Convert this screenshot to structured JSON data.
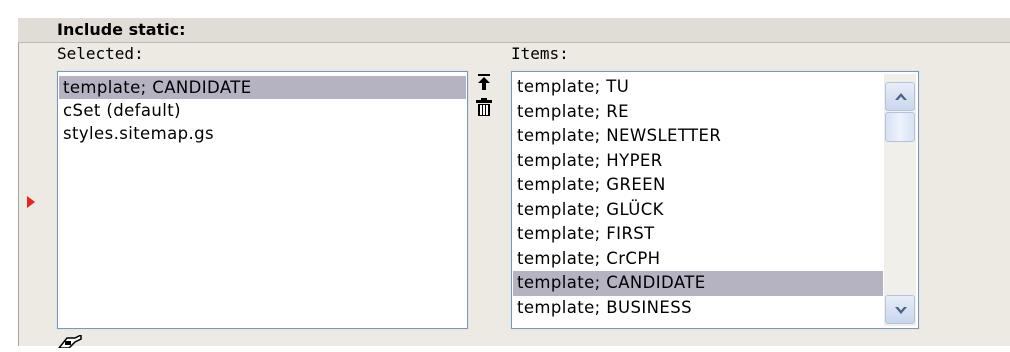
{
  "field": {
    "title": "Include static:"
  },
  "selected": {
    "label": "Selected:",
    "options": [
      {
        "text": "template; CANDIDATE",
        "highlighted": true
      },
      {
        "text": "cSet (default)",
        "highlighted": false
      },
      {
        "text": "styles.sitemap.gs",
        "highlighted": false
      }
    ]
  },
  "items": {
    "label": "Items:",
    "options": [
      {
        "text": "template; TU",
        "highlighted": false
      },
      {
        "text": "template; RE",
        "highlighted": false
      },
      {
        "text": "template; NEWSLETTER",
        "highlighted": false
      },
      {
        "text": "template; HYPER",
        "highlighted": false
      },
      {
        "text": "template; GREEN",
        "highlighted": false
      },
      {
        "text": "template; GLÜCK",
        "highlighted": false
      },
      {
        "text": "template; FIRST",
        "highlighted": false
      },
      {
        "text": "template; CrCPH",
        "highlighted": false
      },
      {
        "text": "template; CANDIDATE",
        "highlighted": true
      },
      {
        "text": "template; BUSINESS",
        "highlighted": false
      }
    ]
  },
  "controls": {
    "move_top_icon": "move-to-top-icon",
    "remove_icon": "trash-icon"
  },
  "colors": {
    "panel_bg": "#ede9e3",
    "highlight": "#b5b2c1",
    "listbox_border": "#7d98b5",
    "marker": "#e8251c"
  }
}
